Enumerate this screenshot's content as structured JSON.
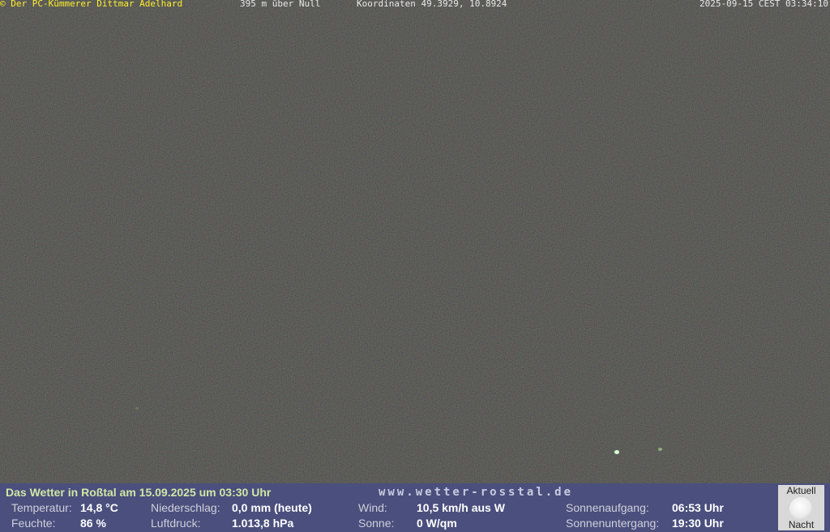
{
  "overlay": {
    "copyright": "© Der PC-Kümmerer Dittmar Adelhard",
    "altitude": "395 m über Null",
    "coordinates": "Koordinaten 49.3929, 10.8924",
    "datetime": "2025-09-15 CEST 03:34:10"
  },
  "weather": {
    "title": "Das Wetter in Roßtal am 15.09.2025 um 03:30 Uhr",
    "website": "www.wetter-rosstal.de",
    "temperature_label": "Temperatur:",
    "temperature_value": "14,8 °C",
    "humidity_label": "Feuchte:",
    "humidity_value": "86 %",
    "precipitation_label": "Niederschlag:",
    "precipitation_value": "0,0 mm (heute)",
    "pressure_label": "Luftdruck:",
    "pressure_value": "1.013,8 hPa",
    "wind_label": "Wind:",
    "wind_value": "10,5 km/h aus W",
    "sun_label": "Sonne:",
    "sun_value": "0 W/qm",
    "sunrise_label": "Sonnenaufgang:",
    "sunrise_value": "06:53 Uhr",
    "sunset_label": "Sonnenuntergang:",
    "sunset_value": "19:30 Uhr"
  },
  "moon": {
    "label_top": "Aktuell",
    "label_bottom": "Nacht",
    "icon": "full-moon-icon"
  },
  "colors": {
    "overlay_highlight": "#ffef2a",
    "panel_background": "#4a4f7d",
    "title_color": "#cfe7a4"
  }
}
